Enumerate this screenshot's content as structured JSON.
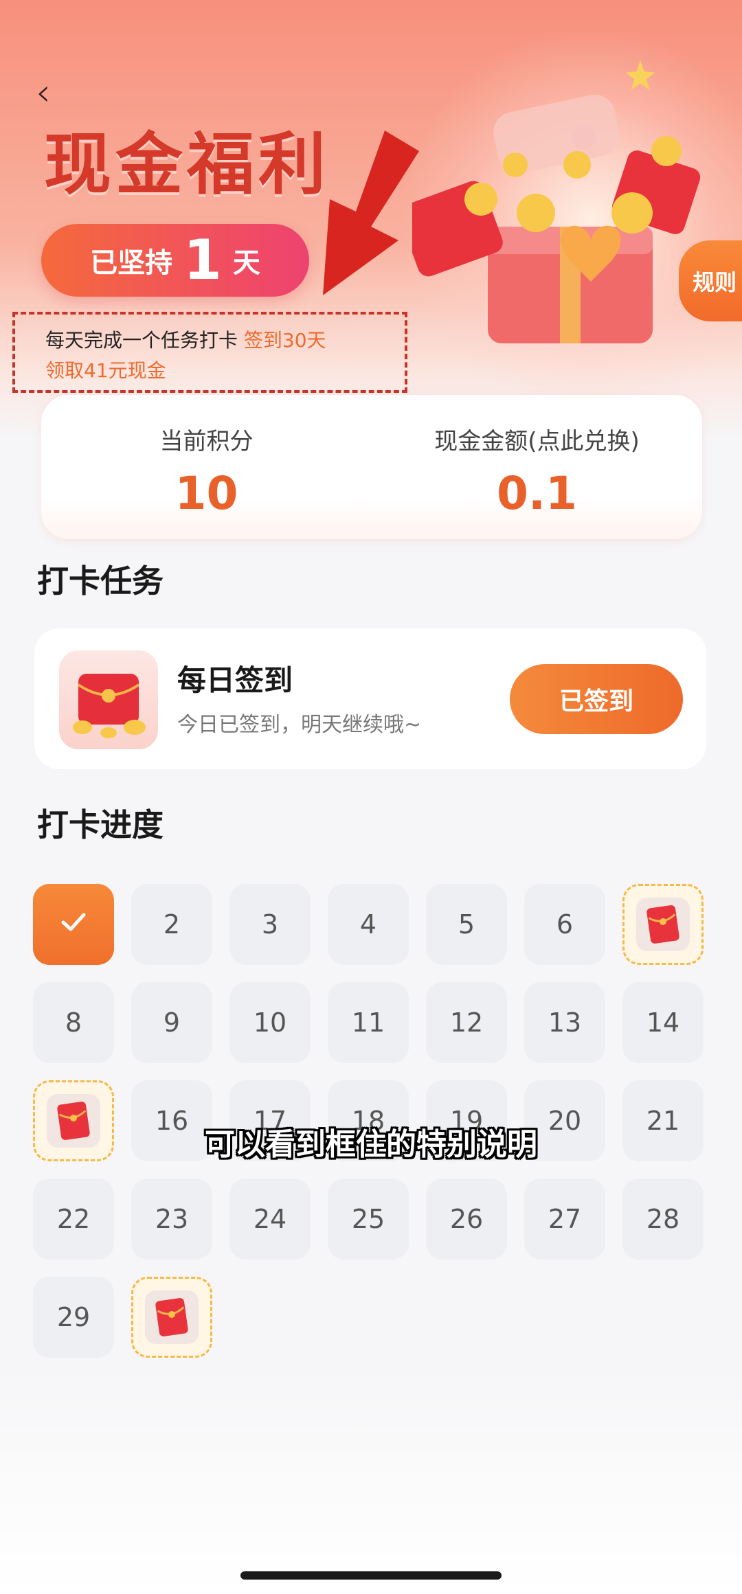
{
  "header": {
    "back_icon": "chevron-left-icon",
    "title": "现金福利",
    "streak_prefix": "已坚持",
    "streak_days": "1",
    "streak_suffix": "天",
    "note_text": "每天完成一个任务打卡 ",
    "note_highlight_1": "签到30天",
    "note_highlight_2": "领取41元现金",
    "rules_label": "规则"
  },
  "stats": {
    "points_label": "当前积分",
    "points_value": "10",
    "cash_label": "现金金额(点此兑换)",
    "cash_value": "0.1"
  },
  "tasks": {
    "heading": "打卡任务",
    "daily": {
      "title": "每日签到",
      "subtitle": "今日已签到，明天继续哦~",
      "button_label": "已签到"
    }
  },
  "progress": {
    "heading": "打卡进度",
    "days": [
      {
        "label": "",
        "state": "done"
      },
      {
        "label": "2",
        "state": "normal"
      },
      {
        "label": "3",
        "state": "normal"
      },
      {
        "label": "4",
        "state": "normal"
      },
      {
        "label": "5",
        "state": "normal"
      },
      {
        "label": "6",
        "state": "normal"
      },
      {
        "label": "",
        "state": "bonus"
      },
      {
        "label": "8",
        "state": "normal"
      },
      {
        "label": "9",
        "state": "normal"
      },
      {
        "label": "10",
        "state": "normal"
      },
      {
        "label": "11",
        "state": "normal"
      },
      {
        "label": "12",
        "state": "normal"
      },
      {
        "label": "13",
        "state": "normal"
      },
      {
        "label": "14",
        "state": "normal"
      },
      {
        "label": "",
        "state": "bonus"
      },
      {
        "label": "16",
        "state": "normal"
      },
      {
        "label": "17",
        "state": "normal"
      },
      {
        "label": "18",
        "state": "normal"
      },
      {
        "label": "19",
        "state": "normal"
      },
      {
        "label": "20",
        "state": "normal"
      },
      {
        "label": "21",
        "state": "normal"
      },
      {
        "label": "22",
        "state": "normal"
      },
      {
        "label": "23",
        "state": "normal"
      },
      {
        "label": "24",
        "state": "normal"
      },
      {
        "label": "25",
        "state": "normal"
      },
      {
        "label": "26",
        "state": "normal"
      },
      {
        "label": "27",
        "state": "normal"
      },
      {
        "label": "28",
        "state": "normal"
      },
      {
        "label": "29",
        "state": "normal"
      },
      {
        "label": "",
        "state": "bonus"
      }
    ]
  },
  "caption": "可以看到框住的特别说明",
  "colors": {
    "accent": "#ef6a2c",
    "title_red": "#d4392a",
    "annotation_red": "#c6352a"
  }
}
